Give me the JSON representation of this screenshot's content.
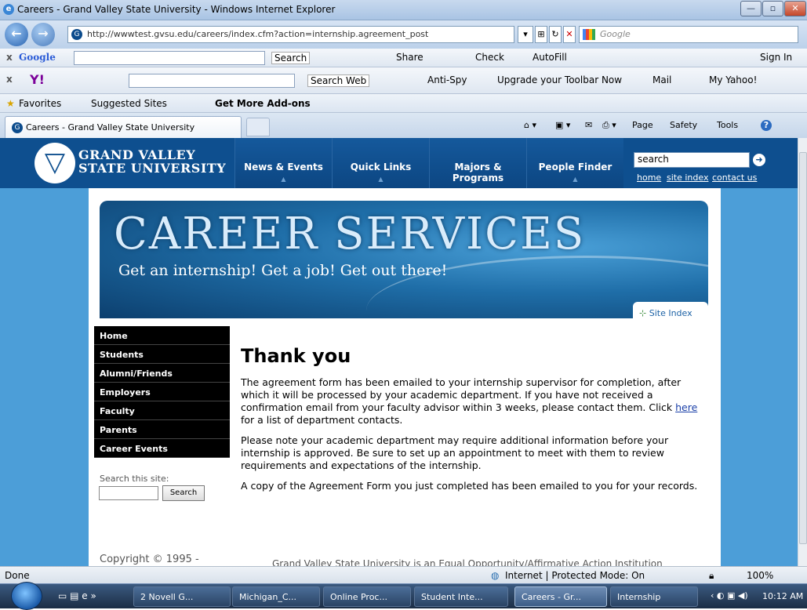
{
  "window": {
    "title": "Careers - Grand Valley State University - Windows Internet Explorer"
  },
  "address": {
    "url": "http://wwwtest.gvsu.edu/careers/index.cfm?action=internship.agreement_post",
    "search_placeholder": "Google"
  },
  "google_toolbar": {
    "label": "Google",
    "search": "Search",
    "share": "Share",
    "check": "Check",
    "autofill": "AutoFill",
    "sign_in": "Sign In"
  },
  "yahoo_toolbar": {
    "search_web": "Search Web",
    "anti_spy": "Anti-Spy",
    "upgrade": "Upgrade your Toolbar Now",
    "mail": "Mail",
    "my_yahoo": "My Yahoo!"
  },
  "favorites_bar": {
    "favorites": "Favorites",
    "suggested": "Suggested Sites",
    "addons": "Get More Add-ons"
  },
  "tabs": [
    {
      "label": "Careers - Grand Valley State University"
    }
  ],
  "command_bar": {
    "page": "Page",
    "safety": "Safety",
    "tools": "Tools"
  },
  "gv_header": {
    "logo_line1": "GRAND VALLEY",
    "logo_line2": "STATE UNIVERSITY",
    "nav": [
      "News & Events",
      "Quick Links",
      "Majors & Programs",
      "People Finder"
    ],
    "search_value": "search",
    "links": [
      "home",
      "site index",
      "contact us"
    ]
  },
  "banner": {
    "title": "CAREER SERVICES",
    "tagline": "Get an internship! Get a job! Get out there!",
    "site_index": "Site Index"
  },
  "sidenav": {
    "items": [
      "Home",
      "Students",
      "Alumni/Friends",
      "Employers",
      "Faculty",
      "Parents",
      "Career Events"
    ],
    "search_label": "Search this site:",
    "search_button": "Search"
  },
  "main": {
    "heading": "Thank you",
    "p1_before": "The agreement form has been emailed to your internship supervisor for completion, after which it will be processed by your academic department. If you have not received a confirmation email from your faculty advisor within 3 weeks, please contact them. Click ",
    "p1_link": "here",
    "p1_after": " for a list of department contacts.",
    "p2": "Please note your academic department may require additional information before your internship is approved. Be sure to set up an appointment to meet with them to review requirements and expectations of the internship.",
    "p3": "A copy of the Agreement Form you just completed has been emailed to you for your records."
  },
  "footer": {
    "copyright": "Copyright © 1995 -",
    "eeo": "Grand Valley State University is an Equal Opportunity/Affirmative Action Institution"
  },
  "status": {
    "left": "Done",
    "zone": "Internet | Protected Mode: On",
    "zoom": "100%"
  },
  "taskbar": {
    "items": [
      "2 Novell G...",
      "Michigan_C...",
      "Online Proc...",
      "Student Inte...",
      "Careers - Gr...",
      "Internship"
    ],
    "clock": "10:12 AM"
  }
}
